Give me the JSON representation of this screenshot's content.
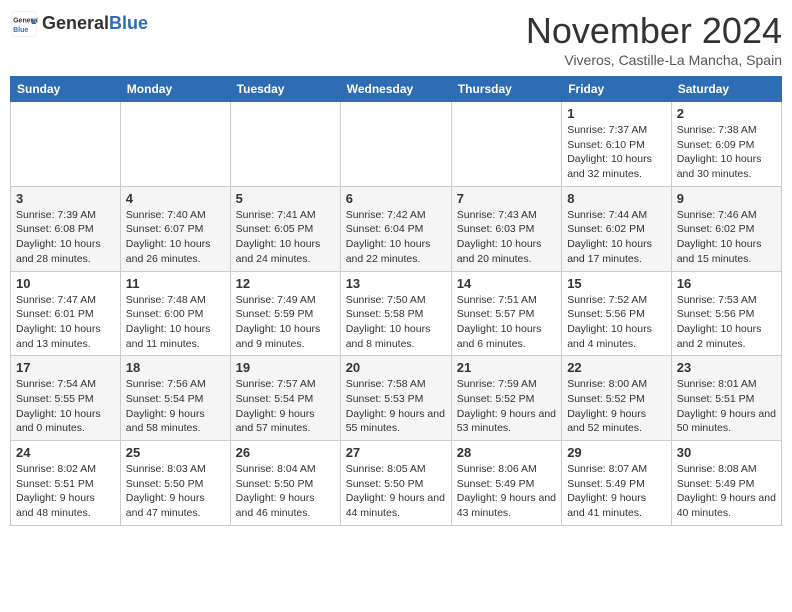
{
  "header": {
    "logo_general": "General",
    "logo_blue": "Blue",
    "month": "November 2024",
    "location": "Viveros, Castille-La Mancha, Spain"
  },
  "weekdays": [
    "Sunday",
    "Monday",
    "Tuesday",
    "Wednesday",
    "Thursday",
    "Friday",
    "Saturday"
  ],
  "weeks": [
    [
      {
        "day": "",
        "info": ""
      },
      {
        "day": "",
        "info": ""
      },
      {
        "day": "",
        "info": ""
      },
      {
        "day": "",
        "info": ""
      },
      {
        "day": "",
        "info": ""
      },
      {
        "day": "1",
        "info": "Sunrise: 7:37 AM\nSunset: 6:10 PM\nDaylight: 10 hours and 32 minutes."
      },
      {
        "day": "2",
        "info": "Sunrise: 7:38 AM\nSunset: 6:09 PM\nDaylight: 10 hours and 30 minutes."
      }
    ],
    [
      {
        "day": "3",
        "info": "Sunrise: 7:39 AM\nSunset: 6:08 PM\nDaylight: 10 hours and 28 minutes."
      },
      {
        "day": "4",
        "info": "Sunrise: 7:40 AM\nSunset: 6:07 PM\nDaylight: 10 hours and 26 minutes."
      },
      {
        "day": "5",
        "info": "Sunrise: 7:41 AM\nSunset: 6:05 PM\nDaylight: 10 hours and 24 minutes."
      },
      {
        "day": "6",
        "info": "Sunrise: 7:42 AM\nSunset: 6:04 PM\nDaylight: 10 hours and 22 minutes."
      },
      {
        "day": "7",
        "info": "Sunrise: 7:43 AM\nSunset: 6:03 PM\nDaylight: 10 hours and 20 minutes."
      },
      {
        "day": "8",
        "info": "Sunrise: 7:44 AM\nSunset: 6:02 PM\nDaylight: 10 hours and 17 minutes."
      },
      {
        "day": "9",
        "info": "Sunrise: 7:46 AM\nSunset: 6:02 PM\nDaylight: 10 hours and 15 minutes."
      }
    ],
    [
      {
        "day": "10",
        "info": "Sunrise: 7:47 AM\nSunset: 6:01 PM\nDaylight: 10 hours and 13 minutes."
      },
      {
        "day": "11",
        "info": "Sunrise: 7:48 AM\nSunset: 6:00 PM\nDaylight: 10 hours and 11 minutes."
      },
      {
        "day": "12",
        "info": "Sunrise: 7:49 AM\nSunset: 5:59 PM\nDaylight: 10 hours and 9 minutes."
      },
      {
        "day": "13",
        "info": "Sunrise: 7:50 AM\nSunset: 5:58 PM\nDaylight: 10 hours and 8 minutes."
      },
      {
        "day": "14",
        "info": "Sunrise: 7:51 AM\nSunset: 5:57 PM\nDaylight: 10 hours and 6 minutes."
      },
      {
        "day": "15",
        "info": "Sunrise: 7:52 AM\nSunset: 5:56 PM\nDaylight: 10 hours and 4 minutes."
      },
      {
        "day": "16",
        "info": "Sunrise: 7:53 AM\nSunset: 5:56 PM\nDaylight: 10 hours and 2 minutes."
      }
    ],
    [
      {
        "day": "17",
        "info": "Sunrise: 7:54 AM\nSunset: 5:55 PM\nDaylight: 10 hours and 0 minutes."
      },
      {
        "day": "18",
        "info": "Sunrise: 7:56 AM\nSunset: 5:54 PM\nDaylight: 9 hours and 58 minutes."
      },
      {
        "day": "19",
        "info": "Sunrise: 7:57 AM\nSunset: 5:54 PM\nDaylight: 9 hours and 57 minutes."
      },
      {
        "day": "20",
        "info": "Sunrise: 7:58 AM\nSunset: 5:53 PM\nDaylight: 9 hours and 55 minutes."
      },
      {
        "day": "21",
        "info": "Sunrise: 7:59 AM\nSunset: 5:52 PM\nDaylight: 9 hours and 53 minutes."
      },
      {
        "day": "22",
        "info": "Sunrise: 8:00 AM\nSunset: 5:52 PM\nDaylight: 9 hours and 52 minutes."
      },
      {
        "day": "23",
        "info": "Sunrise: 8:01 AM\nSunset: 5:51 PM\nDaylight: 9 hours and 50 minutes."
      }
    ],
    [
      {
        "day": "24",
        "info": "Sunrise: 8:02 AM\nSunset: 5:51 PM\nDaylight: 9 hours and 48 minutes."
      },
      {
        "day": "25",
        "info": "Sunrise: 8:03 AM\nSunset: 5:50 PM\nDaylight: 9 hours and 47 minutes."
      },
      {
        "day": "26",
        "info": "Sunrise: 8:04 AM\nSunset: 5:50 PM\nDaylight: 9 hours and 46 minutes."
      },
      {
        "day": "27",
        "info": "Sunrise: 8:05 AM\nSunset: 5:50 PM\nDaylight: 9 hours and 44 minutes."
      },
      {
        "day": "28",
        "info": "Sunrise: 8:06 AM\nSunset: 5:49 PM\nDaylight: 9 hours and 43 minutes."
      },
      {
        "day": "29",
        "info": "Sunrise: 8:07 AM\nSunset: 5:49 PM\nDaylight: 9 hours and 41 minutes."
      },
      {
        "day": "30",
        "info": "Sunrise: 8:08 AM\nSunset: 5:49 PM\nDaylight: 9 hours and 40 minutes."
      }
    ]
  ]
}
